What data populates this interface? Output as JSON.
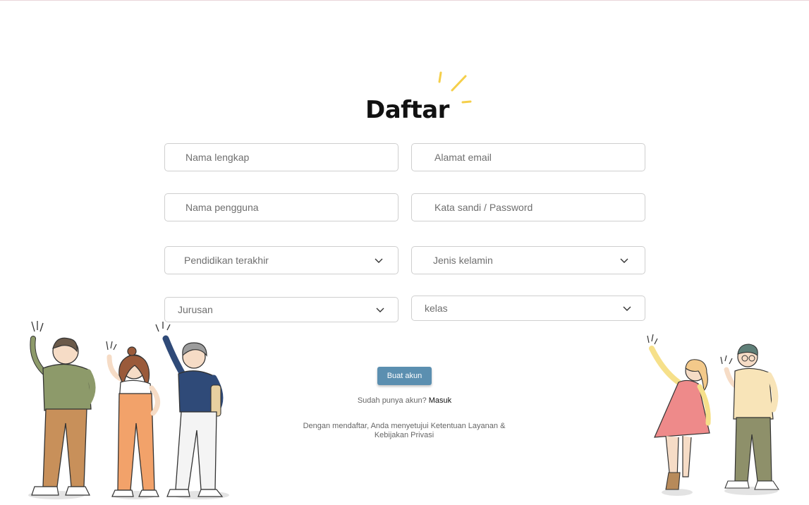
{
  "form": {
    "title": "Daftar",
    "fields": {
      "full_name": {
        "placeholder": "Nama lengkap",
        "value": ""
      },
      "email": {
        "placeholder": "Alamat email",
        "value": ""
      },
      "username": {
        "placeholder": "Nama pengguna",
        "value": ""
      },
      "password": {
        "placeholder": "Kata sandi / Password",
        "value": ""
      }
    },
    "selects": {
      "education": "Pendidikan terakhir",
      "gender": "Jenis kelamin",
      "major": "Jurusan",
      "class": "kelas"
    },
    "submit_label": "Buat akun",
    "login_prompt": "Sudah punya akun?",
    "login_link": "Masuk",
    "terms_text": "Dengan mendaftar, Anda menyetujui Ketentuan Layanan & Kebijakan Privasi"
  },
  "colors": {
    "accent_button": "#5b8fb0",
    "sparkle": "#f5cf4a",
    "border": "#cfcfcf"
  },
  "icons": [
    "sparkle-icon",
    "chevron-down-icon"
  ]
}
